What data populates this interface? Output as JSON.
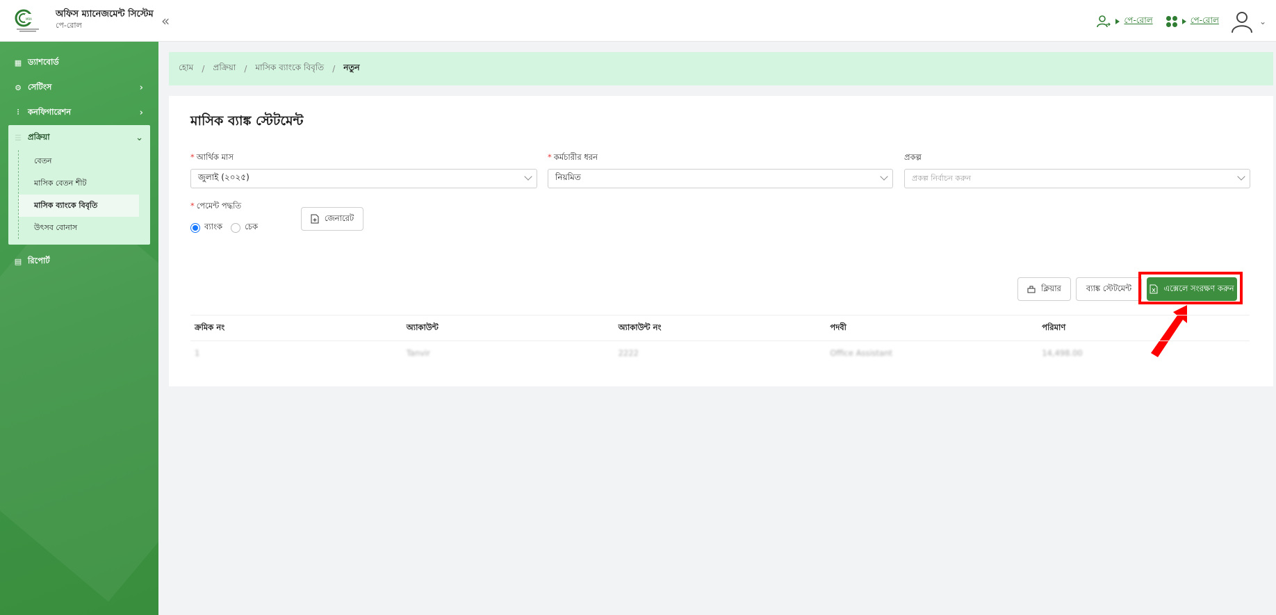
{
  "header": {
    "app_title": "অফিস ম্যানেজমেন্ট সিস্টেম",
    "app_subtitle": "পে-রোল",
    "logo_text": "Microcredit Regulatory Authority",
    "collapse_icon": "«",
    "links": [
      {
        "icon": "user-switch-icon",
        "label": "পে-রোল"
      },
      {
        "icon": "apps-grid-icon",
        "label": "পে-রোল"
      }
    ]
  },
  "sidebar": {
    "items": [
      {
        "icon": "dashboard-icon",
        "label": "ড্যাশবোর্ড"
      },
      {
        "icon": "settings-icon",
        "label": "সেটিংস"
      },
      {
        "icon": "sliders-icon",
        "label": "কনফিগারেশন"
      },
      {
        "icon": "process-icon",
        "label": "প্রক্রিয়া"
      },
      {
        "icon": "report-icon",
        "label": "রিপোর্ট"
      }
    ],
    "sub_items": [
      {
        "label": "বেতন"
      },
      {
        "label": "মাসিক বেতন শীট"
      },
      {
        "label": "মাসিক ব্যাংকে বিবৃতি"
      },
      {
        "label": "উৎসব বোনাস"
      }
    ]
  },
  "breadcrumb": [
    "হোম",
    "প্রক্রিয়া",
    "মাসিক ব্যাংকে বিবৃতি",
    "নতুন"
  ],
  "page": {
    "title": "মাসিক ব্যাঙ্ক স্টেটমেন্ট"
  },
  "form": {
    "fiscal_month": {
      "label": "আর্থিক মাস",
      "value": "জুলাই (২০২৫)"
    },
    "employee_type": {
      "label": "কর্মচারীর ধরন",
      "value": "নিয়মিত"
    },
    "project": {
      "label": "প্রকল্প",
      "placeholder": "প্রকল্প নির্বাচন করুন"
    },
    "payment_method": {
      "label": "পেমেন্ট পদ্ধতি",
      "options": [
        {
          "label": "ব্যাংক",
          "checked": true
        },
        {
          "label": "চেক",
          "checked": false
        }
      ]
    },
    "generate_label": "জেনারেট"
  },
  "actions": {
    "clear_label": "ক্লিয়ার",
    "bank_statement_label": "ব্যাঙ্ক স্টেটমেন্ট",
    "excel_save_label": "এক্সেলে সংরক্ষণ করুন"
  },
  "table": {
    "headers": [
      "ক্রমিক নং",
      "অ্যাকাউন্ট",
      "অ্যাকাউন্ট নং",
      "পদবী",
      "পরিমাণ"
    ],
    "rows": [
      [
        "1",
        "Tanvir",
        "2222",
        "Office Assistant",
        "14,498.00"
      ]
    ]
  },
  "colors": {
    "sidebar_green": "#43a047",
    "primary_button": "#3d8f3f",
    "breadcrumb_bg": "#d4f5e0",
    "highlight_red": "#ff0000"
  }
}
